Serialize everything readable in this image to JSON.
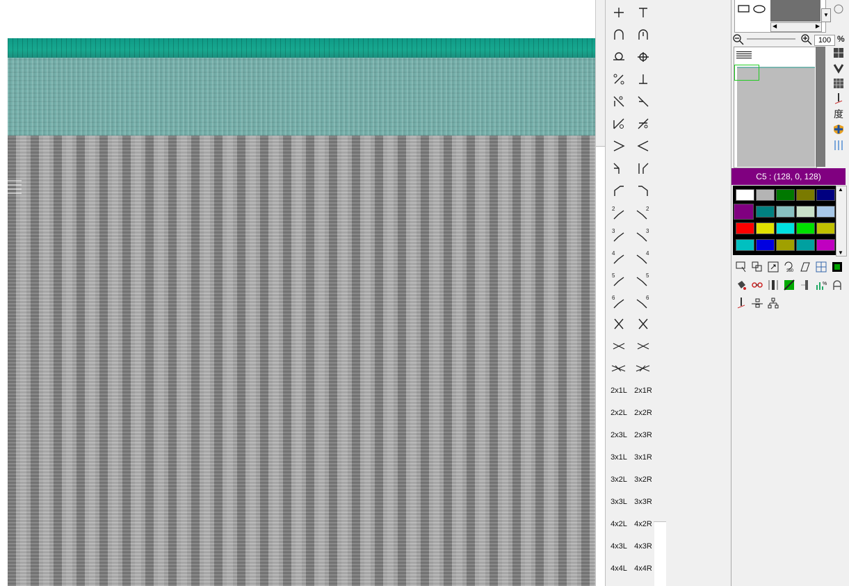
{
  "canvas": {
    "description_none": ""
  },
  "stitch_palette": {
    "text_buttons": [
      [
        "2x1L",
        "2x1R"
      ],
      [
        "2x2L",
        "2x2R"
      ],
      [
        "2x3L",
        "2x3R"
      ],
      [
        "3x1L",
        "3x1R"
      ],
      [
        "3x2L",
        "3x2R"
      ],
      [
        "3x3L",
        "3x3R"
      ],
      [
        "4x2L",
        "4x2R"
      ],
      [
        "4x3L",
        "4x3R"
      ],
      [
        "4x4L",
        "4x4R"
      ]
    ],
    "number_labels": [
      "2",
      "3",
      "4",
      "5",
      "6"
    ]
  },
  "right_panel": {
    "zoom_value": "100",
    "zoom_unit": "%",
    "current_color_label": "C5 : (128, 0, 128)",
    "degree_glyph": "度",
    "colors": {
      "current": "#800080",
      "palette": [
        [
          "#ffffff",
          "#b4b4b4",
          "#007800",
          "#7a7a00",
          "#000080"
        ],
        [
          "#800080",
          "#008080",
          "#88c0c0",
          "#c8e0c8",
          "#a8c8e8"
        ],
        [
          "#ff0000",
          "#e0e000",
          "#00e0e0",
          "#00e000",
          "#c0c000"
        ],
        [
          "#00c0c0",
          "#0000e0",
          "#a0a000",
          "#00a0a0",
          "#c000c0"
        ]
      ]
    }
  }
}
